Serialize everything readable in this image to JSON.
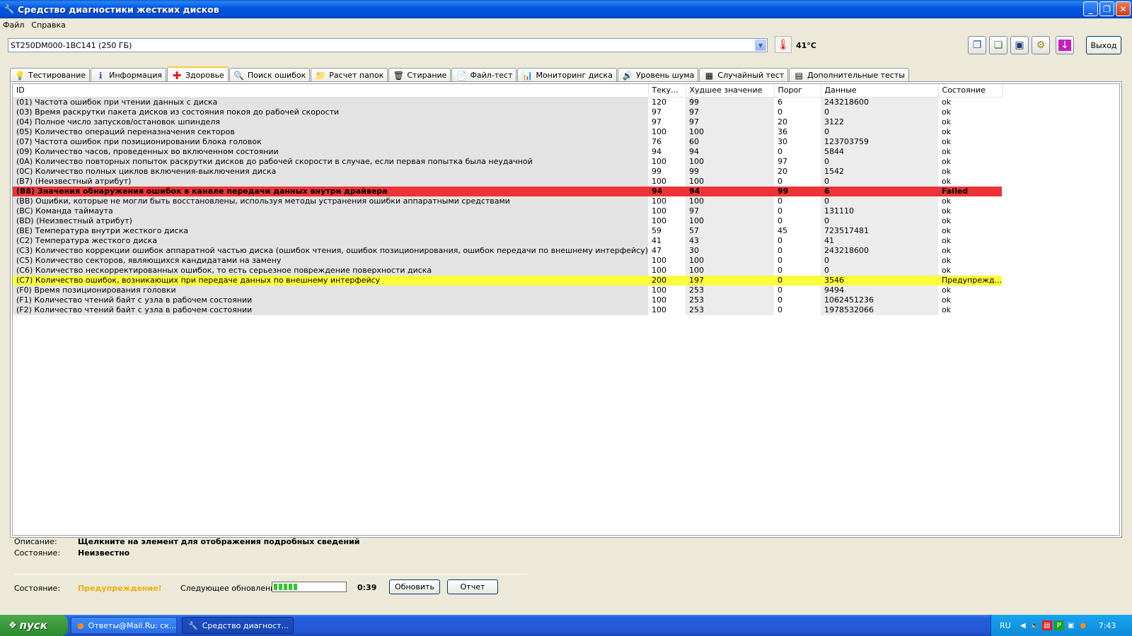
{
  "window": {
    "title": "Средство диагностики жестких дисков",
    "minimize_glyph": "_",
    "maximize_glyph": "❐",
    "close_glyph": "✕"
  },
  "menu": [
    {
      "label": "Файл"
    },
    {
      "label": "Справка"
    }
  ],
  "toolbar": {
    "drive": "ST250DM000-1BC141 (250 ГБ)",
    "temperature": "41°C",
    "exit_label": "Выход",
    "icons": [
      "copy-icon",
      "paste-icon",
      "save-icon",
      "settings-icon",
      "download-icon"
    ]
  },
  "tabs": [
    {
      "label": "Тестирование",
      "icon": "💡"
    },
    {
      "label": "Информация",
      "icon": "ℹ"
    },
    {
      "label": "Здоровье",
      "icon": "✚",
      "active": true
    },
    {
      "label": "Поиск ошибок",
      "icon": "🔍"
    },
    {
      "label": "Расчет папок",
      "icon": "📁"
    },
    {
      "label": "Стирание",
      "icon": "🗑"
    },
    {
      "label": "Файл-тест",
      "icon": "📄"
    },
    {
      "label": "Мониторинг диска",
      "icon": "📊"
    },
    {
      "label": "Уровень шума",
      "icon": "🔊"
    },
    {
      "label": "Случайный тест",
      "icon": "▦"
    },
    {
      "label": "Дополнительные тесты",
      "icon": "▤"
    }
  ],
  "table": {
    "columns": [
      "ID",
      "Теку...",
      "Худшее значение",
      "Порог",
      "Данные",
      "Состояние"
    ],
    "rows": [
      {
        "id": "(01) Частота ошибок при чтении данных с диска",
        "cur": "120",
        "worst": "99",
        "thr": "6",
        "data": "243218600",
        "state": "ok"
      },
      {
        "id": "(03) Время раскрутки пакета дисков из состояния покоя до рабочей скорости",
        "cur": "97",
        "worst": "97",
        "thr": "0",
        "data": "0",
        "state": "ok"
      },
      {
        "id": "(04) Полное число запусков/остановок шпинделя",
        "cur": "97",
        "worst": "97",
        "thr": "20",
        "data": "3122",
        "state": "ok"
      },
      {
        "id": "(05) Количество операций переназначения секторов",
        "cur": "100",
        "worst": "100",
        "thr": "36",
        "data": "0",
        "state": "ok"
      },
      {
        "id": "(07) Частота ошибок при позиционировании блока головок",
        "cur": "76",
        "worst": "60",
        "thr": "30",
        "data": "123703759",
        "state": "ok"
      },
      {
        "id": "(09) Количество часов, проведенных во включенном состоянии",
        "cur": "94",
        "worst": "94",
        "thr": "0",
        "data": "5844",
        "state": "ok"
      },
      {
        "id": "(0A) Количество повторных попыток раскрутки дисков до рабочей скорости в случае, если первая попытка была неудачной",
        "cur": "100",
        "worst": "100",
        "thr": "97",
        "data": "0",
        "state": "ok"
      },
      {
        "id": "(0C) Количество полных циклов включения-выключения диска",
        "cur": "99",
        "worst": "99",
        "thr": "20",
        "data": "1542",
        "state": "ok"
      },
      {
        "id": "(B7) (Неизвестный атрибут)",
        "cur": "100",
        "worst": "100",
        "thr": "0",
        "data": "0",
        "state": "ok"
      },
      {
        "id": "(B8) Значения обнаружения ошибок в канале передачи данных внутри драйвера",
        "cur": "94",
        "worst": "94",
        "thr": "99",
        "data": "6",
        "state": "Failed",
        "status": "failed"
      },
      {
        "id": "(BB) Ошибки, которые не могли быть восстановлены, используя методы устранения ошибки аппаратными средствами",
        "cur": "100",
        "worst": "100",
        "thr": "0",
        "data": "0",
        "state": "ok"
      },
      {
        "id": "(BC) Команда таймаута",
        "cur": "100",
        "worst": "97",
        "thr": "0",
        "data": "131110",
        "state": "ok"
      },
      {
        "id": "(BD) (Неизвестный атрибут)",
        "cur": "100",
        "worst": "100",
        "thr": "0",
        "data": "0",
        "state": "ok"
      },
      {
        "id": "(BE) Температура внутри жесткого диска",
        "cur": "59",
        "worst": "57",
        "thr": "45",
        "data": "723517481",
        "state": "ok"
      },
      {
        "id": "(C2) Температура жесткого диска",
        "cur": "41",
        "worst": "43",
        "thr": "0",
        "data": "41",
        "state": "ok"
      },
      {
        "id": "(C3) Количество коррекции ошибок аппаратной частью диска (ошибок чтения, ошибок позиционирования, ошибок передачи по внешнему интерфейсу)",
        "cur": "47",
        "worst": "30",
        "thr": "0",
        "data": "243218600",
        "state": "ok"
      },
      {
        "id": "(C5) Количество секторов, являющихся кандидатами на замену",
        "cur": "100",
        "worst": "100",
        "thr": "0",
        "data": "0",
        "state": "ok"
      },
      {
        "id": "(C6) Количество нескорректированных ошибок, то есть серьезное повреждение поверхности диска",
        "cur": "100",
        "worst": "100",
        "thr": "0",
        "data": "0",
        "state": "ok"
      },
      {
        "id": "(C7) Количество ошибок, возникающих при передаче данных по внешнему интерфейсу",
        "cur": "200",
        "worst": "197",
        "thr": "0",
        "data": "3546",
        "state": "Предупрежд...",
        "status": "warning"
      },
      {
        "id": "(F0) Время позиционирования головки",
        "cur": "100",
        "worst": "253",
        "thr": "0",
        "data": "9494",
        "state": "ok"
      },
      {
        "id": "(F1) Количество чтений байт с узла в рабочем состоянии",
        "cur": "100",
        "worst": "253",
        "thr": "0",
        "data": "1062451236",
        "state": "ok"
      },
      {
        "id": "(F2) Количество чтений байт с узла в рабочем состоянии",
        "cur": "100",
        "worst": "253",
        "thr": "0",
        "data": "1978532066",
        "state": "ok"
      }
    ]
  },
  "details": {
    "description_label": "Описание:",
    "description_value": "Щелкните на элемент для отображения подробных сведений",
    "state_label": "Состояние:",
    "state_value": "Неизвестно"
  },
  "status": {
    "label": "Состояние:",
    "value": "Предупреждение!",
    "value_color": "#f0b010",
    "next_update_label": "Следующее обновление:",
    "progress_fraction": 0.35,
    "countdown": "0:39",
    "refresh_label": "Обновить",
    "report_label": "Отчет"
  },
  "taskbar": {
    "start_label": "пуск",
    "tasks": [
      {
        "label": "Ответы@Mail.Ru: ск...",
        "active": false
      },
      {
        "label": "Средство диагност...",
        "active": true
      }
    ],
    "language": "RU",
    "clock": "7:43"
  }
}
